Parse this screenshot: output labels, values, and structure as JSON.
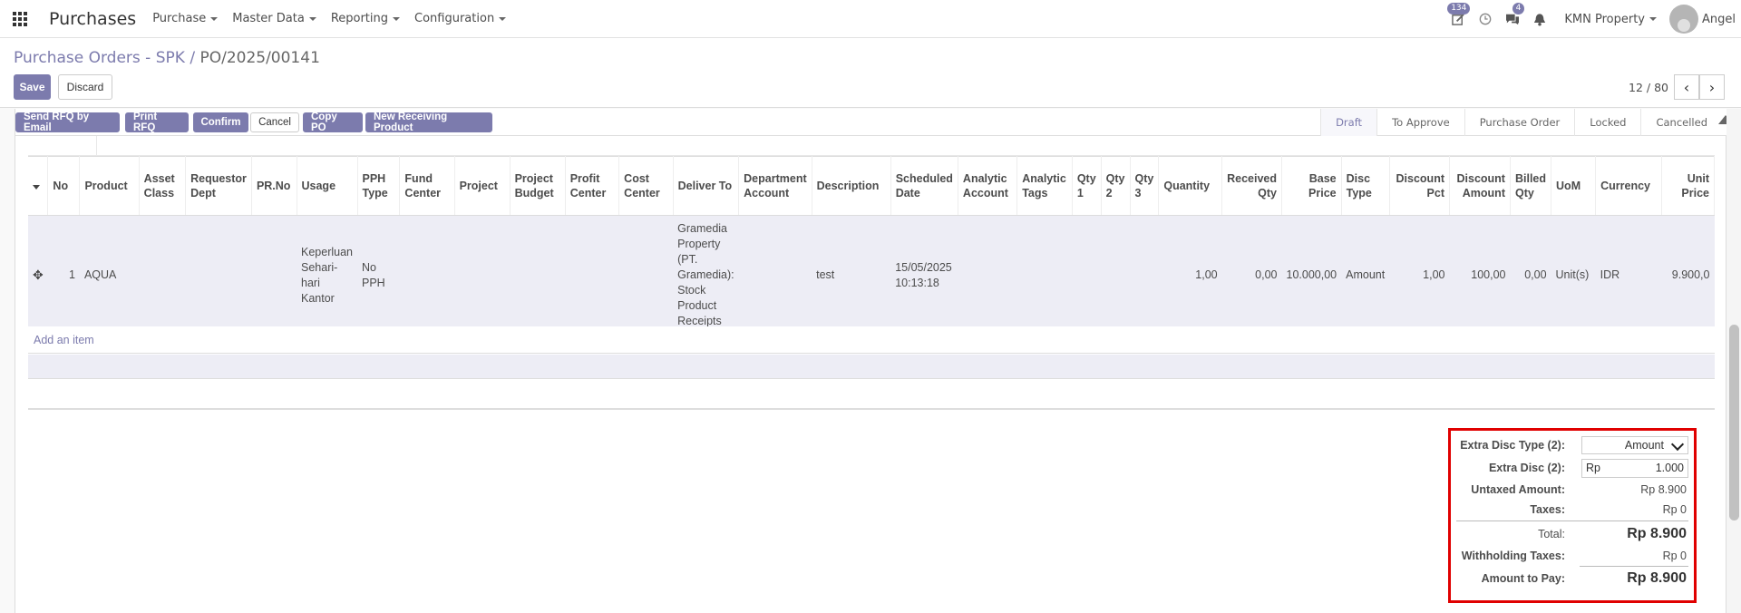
{
  "navbar": {
    "brand": "Purchases",
    "menus": [
      "Purchase",
      "Master Data",
      "Reporting",
      "Configuration"
    ],
    "activity_badge": "134",
    "messages_badge": "4",
    "company": "KMN Property",
    "user": "Angel"
  },
  "control_panel": {
    "breadcrumb_parent": "Purchase Orders - SPK",
    "breadcrumb_sep": "/",
    "breadcrumb_current": "PO/2025/00141",
    "save_label": "Save",
    "discard_label": "Discard",
    "pager_value": "12 / 80"
  },
  "header_buttons": {
    "send_rfq": "Send RFQ by Email",
    "print_rfq": "Print RFQ",
    "confirm": "Confirm",
    "cancel": "Cancel",
    "copy_po": "Copy PO",
    "new_receiving": "New Receiving Product"
  },
  "states": [
    "Draft",
    "To Approve",
    "Purchase Order",
    "Locked",
    "Cancelled"
  ],
  "active_state": "Draft",
  "table": {
    "columns": [
      "No",
      "Product",
      "Asset Class",
      "Requestor Dept",
      "PR.No",
      "Usage",
      "PPH Type",
      "Fund Center",
      "Project",
      "Project Budget",
      "Profit Center",
      "Cost Center",
      "Deliver To",
      "Department Account",
      "Description",
      "Scheduled Date",
      "Analytic Account",
      "Analytic Tags",
      "Qty 1",
      "Qty 2",
      "Qty 3",
      "Quantity",
      "Received Qty",
      "Base Price",
      "Disc Type",
      "Discount Pct",
      "Discount Amount",
      "Billed Qty",
      "UoM",
      "Currency",
      "Unit Price"
    ],
    "row": {
      "no": "1",
      "product": "AQUA",
      "usage": "Keperluan Sehari-hari Kantor",
      "pph_type": "No PPH",
      "deliver_to": "Gramedia Property (PT. Gramedia): Stock Product Receipts",
      "description": "test",
      "scheduled_date": "15/05/2025 10:13:18",
      "quantity": "1,00",
      "received_qty": "0,00",
      "base_price": "10.000,00",
      "disc_type": "Amount",
      "discount_pct": "1,00",
      "discount_amount": "100,00",
      "billed_qty": "0,00",
      "uom": "Unit(s)",
      "currency": "IDR",
      "unit_price": "9.900,0"
    },
    "add_item": "Add an item"
  },
  "totals": {
    "extra_disc_type_label": "Extra Disc Type (2):",
    "extra_disc_type_value": "Amount",
    "extra_disc_label": "Extra Disc (2):",
    "extra_disc_currency": "Rp",
    "extra_disc_value": "1.000",
    "untaxed_label": "Untaxed Amount:",
    "untaxed_value": "Rp 8.900",
    "taxes_label": "Taxes:",
    "taxes_value": "Rp 0",
    "total_label": "Total:",
    "total_value": "Rp 8.900",
    "withholding_label": "Withholding Taxes:",
    "withholding_value": "Rp 0",
    "amount_to_pay_label": "Amount to Pay:",
    "amount_to_pay_value": "Rp 8.900"
  }
}
